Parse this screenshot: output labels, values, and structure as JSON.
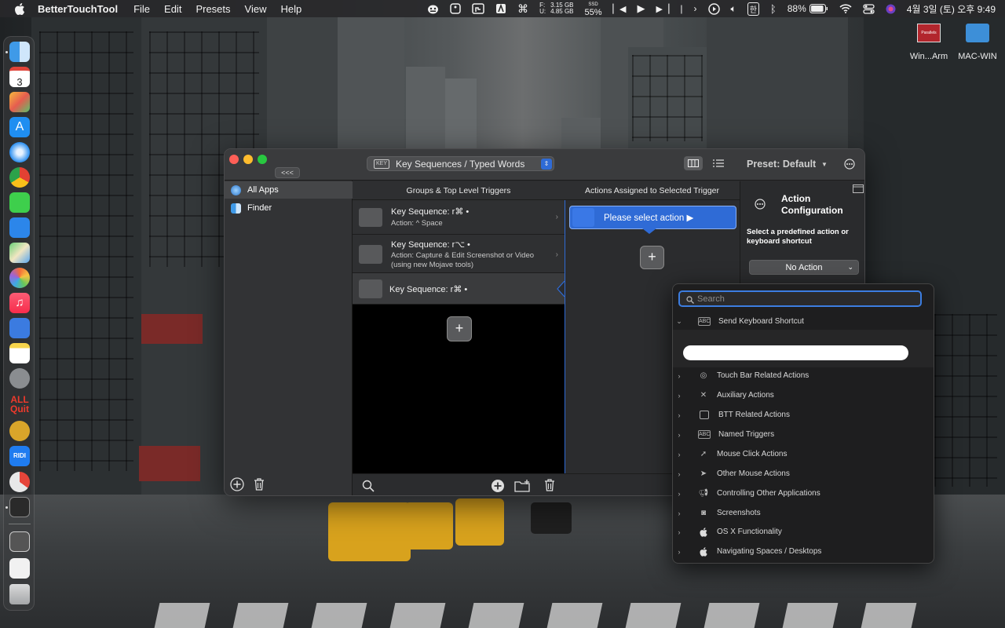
{
  "menubar": {
    "app_name": "BetterTouchTool",
    "menus": [
      "File",
      "Edit",
      "Presets",
      "View",
      "Help"
    ],
    "storage_f": "3.15 GB",
    "storage_u": "4.85 GB",
    "storage_f_label": "F:",
    "storage_u_label": "U:",
    "ssd_label": "SSD",
    "ssd_value": "55%",
    "battery": "88%",
    "clock": "4월 3일 (토) 오후 9:49",
    "input_lang": "한",
    "icons": [
      "bear-icon",
      "square-icon",
      "keyboard-icon",
      "text-icon",
      "command-icon",
      "prev-track-icon",
      "play-icon",
      "next-track-icon",
      "pipe-icon",
      "chevron-icon",
      "play-circle-icon",
      "volume-icon",
      "bluetooth-icon",
      "wifi-icon",
      "control-center-icon",
      "siri-icon"
    ]
  },
  "dock": {
    "calendar_day": "3",
    "all_quit_line1": "ALL",
    "all_quit_line2": "Quit",
    "ridi_label": "RIDI"
  },
  "desktop": {
    "icon1_label": "Win...Arm",
    "icon2_label": "MAC-WIN",
    "parallels_badge": "Parallels"
  },
  "window": {
    "collapse_label": "<<<",
    "trigger_badge": "KEY",
    "trigger_type": "Key Sequences / Typed Words",
    "preset_label": "Preset: Default",
    "sidebar_items": [
      {
        "label": "All Apps",
        "selected": true
      },
      {
        "label": "Finder",
        "selected": false
      }
    ],
    "col_groups": "Groups & Top Level Triggers",
    "col_actions": "Actions Assigned to Selected Trigger",
    "triggers": [
      {
        "title": "Key Sequence: r⌘ •",
        "subtitle": "Action: ^ Space"
      },
      {
        "title": "Key Sequence: r⌥ •",
        "subtitle": "Action: Capture & Edit Screenshot or Video (using new Mojave tools)"
      },
      {
        "title": "Key Sequence: r⌘ •",
        "subtitle": ""
      }
    ],
    "action_button": "Please select action ▶",
    "config_title_1": "Action",
    "config_title_2": "Configuration",
    "config_hint": "Select a predefined action or keyboard shortcut",
    "no_action": "No Action"
  },
  "popover": {
    "search_placeholder": "Search",
    "expanded_item": "Send Keyboard Shortcut",
    "categories": [
      {
        "label": "Touch Bar Related Actions",
        "icon": "touchbar-icon"
      },
      {
        "label": "Auxiliary Actions",
        "icon": "tools-icon"
      },
      {
        "label": "BTT Related Actions",
        "icon": "btt-icon"
      },
      {
        "label": "Named Triggers",
        "icon": "abc-icon"
      },
      {
        "label": "Mouse Click Actions",
        "icon": "mouse-click-icon"
      },
      {
        "label": "Other Mouse Actions",
        "icon": "cursor-icon"
      },
      {
        "label": "Controlling Other Applications",
        "icon": "megaphone-icon"
      },
      {
        "label": "Screenshots",
        "icon": "camera-icon"
      },
      {
        "label": "OS X Functionality",
        "icon": "apple-icon"
      },
      {
        "label": "Navigating Spaces / Desktops",
        "icon": "apple-icon"
      }
    ]
  },
  "colors": {
    "accent": "#2f6bd6",
    "window_bg": "#2b2c2e",
    "popover_bg": "#1e1e1f"
  }
}
